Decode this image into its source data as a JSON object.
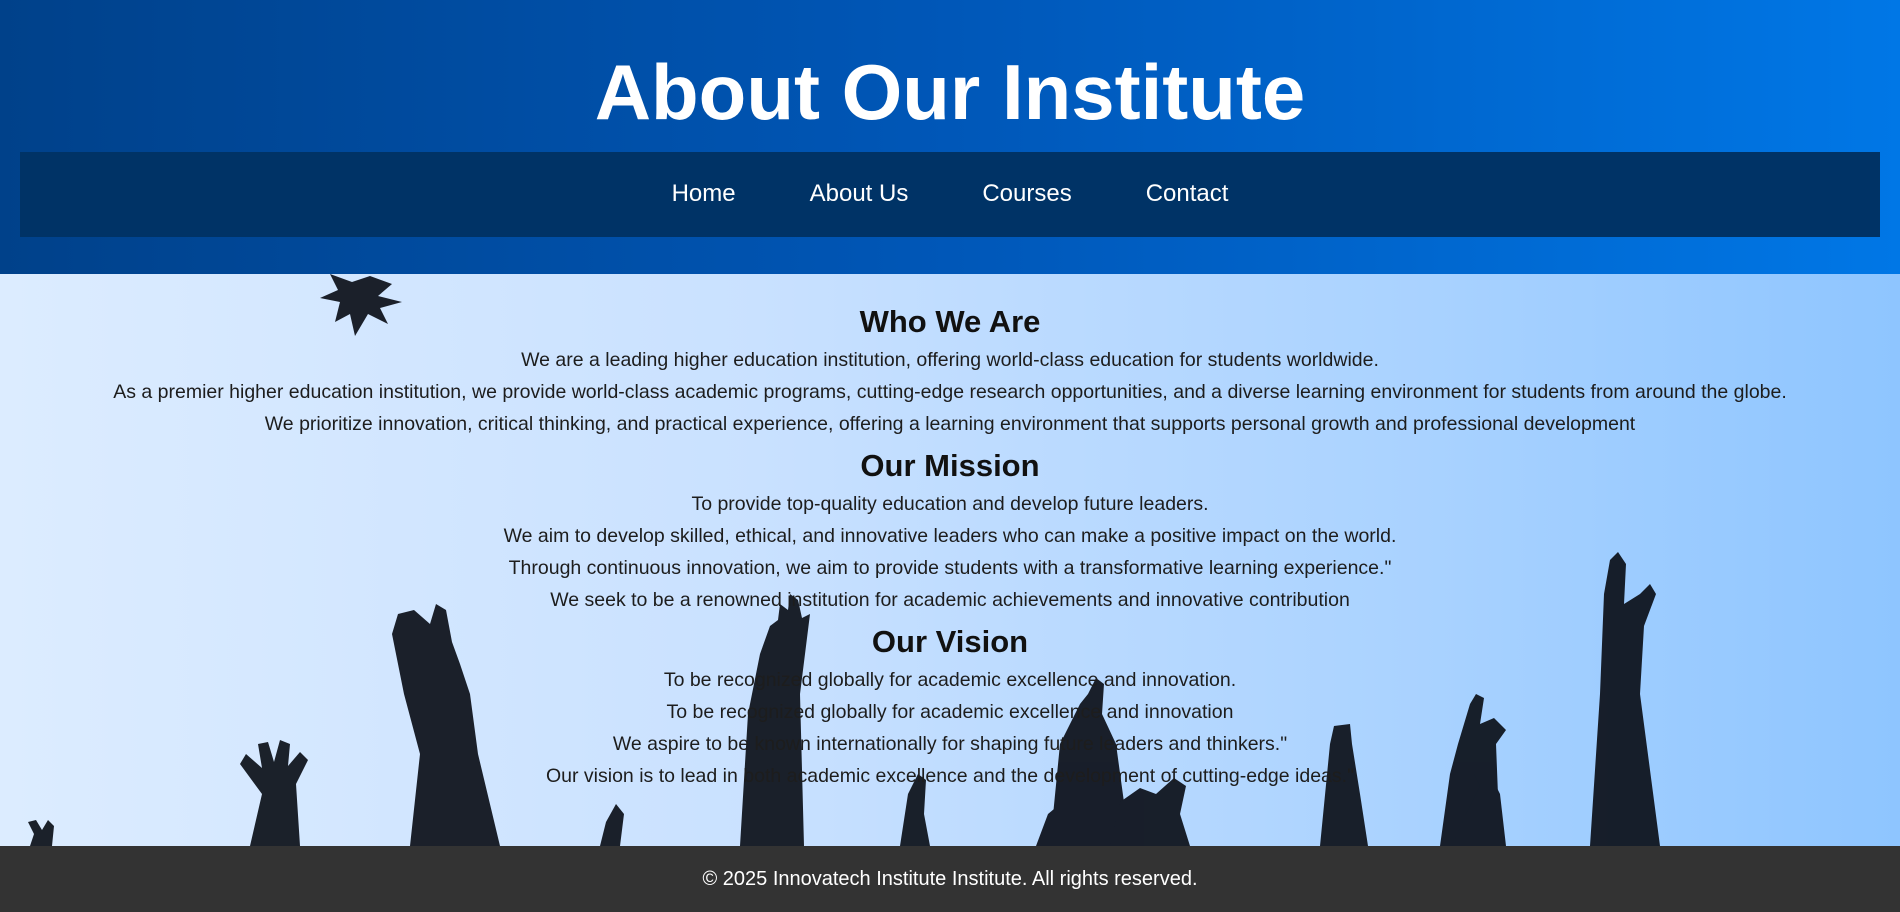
{
  "header": {
    "title": "About Our Institute"
  },
  "nav": {
    "items": [
      {
        "label": "Home"
      },
      {
        "label": "About Us"
      },
      {
        "label": "Courses"
      },
      {
        "label": "Contact"
      }
    ]
  },
  "sections": {
    "who": {
      "heading": "Who We Are",
      "paragraphs": [
        "We are a leading higher education institution, offering world-class education for students worldwide.",
        "As a premier higher education institution, we provide world-class academic programs, cutting-edge research opportunities, and a diverse learning environment for students from around the globe.",
        "We prioritize innovation, critical thinking, and practical experience, offering a learning environment that supports personal growth and professional development"
      ]
    },
    "mission": {
      "heading": "Our Mission",
      "paragraphs": [
        "To provide top-quality education and develop future leaders.",
        "We aim to develop skilled, ethical, and innovative leaders who can make a positive impact on the world.",
        "Through continuous innovation, we aim to provide students with a transformative learning experience.\"",
        "We seek to be a renowned institution for academic achievements and innovative contribution"
      ]
    },
    "vision": {
      "heading": "Our Vision",
      "paragraphs": [
        "To be recognized globally for academic excellence and innovation.",
        "To be recognized globally for academic excellence and innovation",
        "We aspire to be known internationally for shaping future leaders and thinkers.\"",
        "Our vision is to lead in both academic excellence and the development of cutting-edge ideas.\""
      ]
    }
  },
  "footer": {
    "text": "© 2025 Innovatech Institute Institute. All rights reserved."
  },
  "colors": {
    "header_gradient_start": "#00418a",
    "header_gradient_end": "#0077e6",
    "nav_background": "#003366",
    "footer_background": "#333333",
    "text_primary": "#111111"
  }
}
